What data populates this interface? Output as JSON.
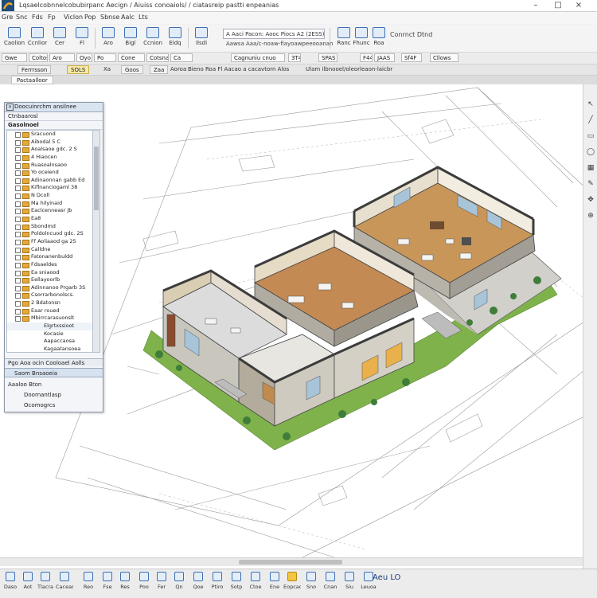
{
  "window": {
    "title": "Lqsaelcobnnelcobubirpanc Aecign / Aiuiss conoaiols/ / ciatasreip pastti enpeanias",
    "controls": [
      "–",
      "□",
      "×"
    ]
  },
  "menu": [
    "Gre",
    "Snc",
    "Fds",
    "Fp",
    "Viclon",
    "Pop",
    "Sbnse",
    "Aalc",
    "Lts"
  ],
  "ribbon": {
    "buttons": [
      "Caolion",
      "Ccnlior",
      "Cer",
      "Fl",
      "Aro",
      "Bigl",
      "Ccnion",
      "Eidq",
      "Ilsdi",
      "Ccsb",
      "Ceno",
      "Foar"
    ],
    "combo_left": "A Aaci Pacon: Aooc Piocs A2 (2ESS)",
    "combo_left_sub": "Aawsa Aaa/c-noaw-fiayoawpeeooanan",
    "right_buttons": [
      "Ranc",
      "Fhunc",
      "Roa"
    ],
    "right_label": "Conrnct Dtnd"
  },
  "optbar": [
    "Gwe",
    "Coltos",
    "Aro",
    "Oyo",
    "Po",
    "Cone",
    "Cotsna",
    "Ca",
    "Cagnuniu cnuo",
    "3T4",
    "SPAS",
    "F44",
    "JAAS",
    "Sf4F",
    "Cllows"
  ],
  "docbar": {
    "tabs": [
      "Ferrrsson",
      "SOLS",
      "Goos",
      "Zaa"
    ],
    "active_tab": "SOLS",
    "texts": [
      "Xa",
      "Aoroa",
      "Bieno",
      "Roa  Fl Aacao a cacavtorn  Alos",
      "Ulam ilbnooel/oleorleaon-laicbr"
    ],
    "doc_tab": "Pactaalloor"
  },
  "panel": {
    "title": "Doocuinrchm ansilnee",
    "subtitle": "Ctnbaarosl",
    "root": "Gasolnoel",
    "layers": [
      "Sracuond",
      "Aibodal 5 C",
      "Aoalsaoe gdc. 2 S",
      "4 Hiaocen",
      "Ruasoalnsaoo",
      "Yo oceiend",
      "Adinaonnan gabb Ed",
      "Kiflnanciogaml 38",
      "N Dcoll",
      "Ma hilyinaid",
      "Eaclcenneasr Jb",
      "Ea8",
      "Sbondmd",
      "Poldolncuod gdc. 2S",
      "Ff Aoliaaod ga 25",
      "Calldne",
      "Fatonanenbuldd",
      "Fdsaeldes",
      "Ea sniaood",
      "Eellayoorlb",
      "Adinnanoo Prgarb 3S",
      "Csorrarbonolscs.",
      "2 Bdatonsn",
      "Eaar roued",
      "Mbirrcarasuonslt"
    ],
    "sub_items": [
      "Elgrtxssioot",
      "Kocasie",
      "Aapaccaosa",
      "Kagaatansoea"
    ],
    "footer": "Pgo Aoa ocin Cooloael Aolls",
    "section": "Saom Bnsaoeia",
    "section_items": [
      "Aaaloo Bton",
      "Doornantlasp",
      "Ocomogrcs"
    ]
  },
  "bottombar": {
    "buttons": [
      "Daso",
      "Aot",
      "Tlacra",
      "Caceans",
      "Reo",
      "Fse",
      "Res",
      "Poo",
      "Fer",
      "Qn",
      "Qoe",
      "Ptiro",
      "Sotp",
      "Ctoe",
      "Ene",
      "Eopcao",
      "Sno",
      "Cnan",
      "Siu",
      "Leuoa",
      "Inos",
      "Lss"
    ],
    "highlight_index": 15,
    "status": "Aeu LO"
  },
  "colors": {
    "accent": "#3b6fb5",
    "highlight": "#f2c641",
    "wall": "#4a4a4a",
    "floor_wood": "#c9935a",
    "grass": "#7fb24b"
  }
}
